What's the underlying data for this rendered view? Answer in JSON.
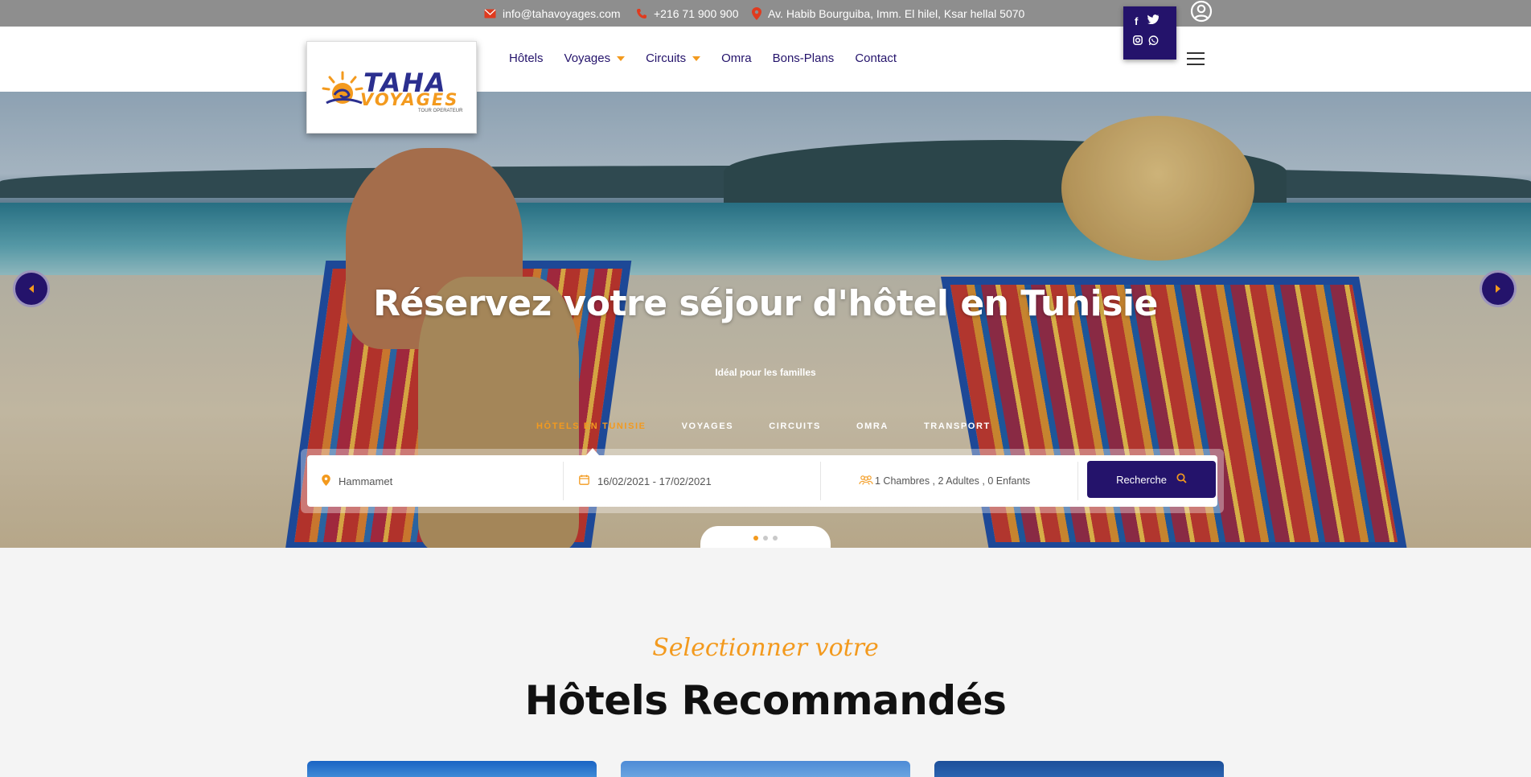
{
  "topbar": {
    "email": "info@tahavoyages.com",
    "phone": "+216 71 900 900",
    "address": "Av. Habib Bourguiba, Imm. El hilel, Ksar hellal 5070",
    "icons": {
      "email": "envelope-icon",
      "phone": "phone-icon",
      "address": "map-pin-icon",
      "user": "user-circle-icon"
    }
  },
  "social": {
    "icons": [
      "facebook-icon",
      "twitter-icon",
      "instagram-icon",
      "whatsapp-icon"
    ]
  },
  "logo": {
    "brand": "TAHA",
    "sub": "VOYAGES",
    "tagline": "TOUR OPERATEUR"
  },
  "nav": {
    "items": [
      {
        "label": "Hôtels",
        "dropdown": false
      },
      {
        "label": "Voyages",
        "dropdown": true
      },
      {
        "label": "Circuits",
        "dropdown": true
      },
      {
        "label": "Omra",
        "dropdown": false
      },
      {
        "label": "Bons-Plans",
        "dropdown": false
      },
      {
        "label": "Contact",
        "dropdown": false
      }
    ]
  },
  "hero": {
    "title": "Réservez votre séjour d'hôtel en Tunisie",
    "subtitle": "Idéal pour les familles",
    "tabs": [
      {
        "label": "HÔTELS EN TUNISIE",
        "active": true
      },
      {
        "label": "VOYAGES",
        "active": false
      },
      {
        "label": "CIRCUITS",
        "active": false
      },
      {
        "label": "OMRA",
        "active": false
      },
      {
        "label": "TRANSPORT",
        "active": false
      }
    ],
    "search": {
      "destination": "Hammamet",
      "dates": "16/02/2021 - 17/02/2021",
      "guests": "1 Chambres , 2 Adultes , 0 Enfants",
      "button": "Recherche"
    },
    "slider": {
      "slides": 3,
      "active_slide": 1
    }
  },
  "colors": {
    "primary": "#24136b",
    "accent": "#f39a1e",
    "topbar": "#8e8e8e",
    "icon_red": "#e03a1e"
  },
  "section": {
    "script_heading": "Selectionner votre",
    "title": "Hôtels Recommandés"
  }
}
